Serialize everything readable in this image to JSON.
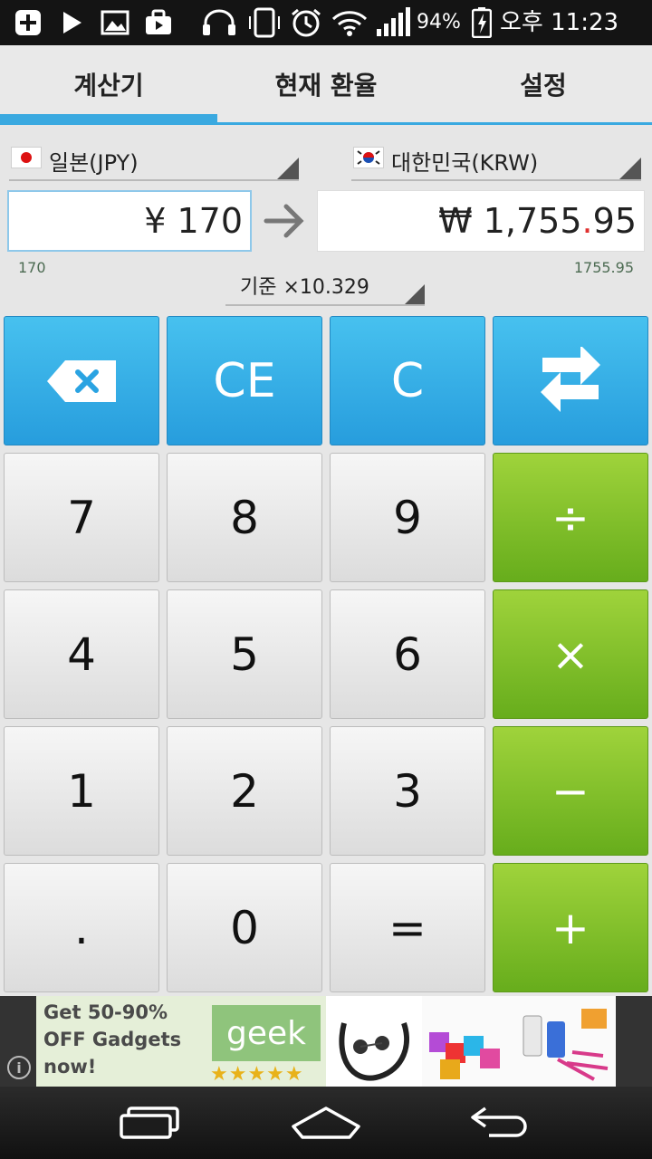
{
  "status_bar": {
    "battery": "94%",
    "time": "오후 11:23",
    "icons": [
      "add-icon",
      "play-icon",
      "image-icon",
      "bag-icon",
      "headset-icon",
      "vibrate-icon",
      "alarm-icon",
      "wifi-icon",
      "signal-icon",
      "battery-icon"
    ]
  },
  "tabs": [
    {
      "label": "계산기",
      "active": true
    },
    {
      "label": "현재 환율",
      "active": false
    },
    {
      "label": "설정",
      "active": false
    }
  ],
  "from_currency": {
    "label": "일본(JPY)",
    "flag": "japan-flag-icon",
    "amount": "¥ 170",
    "raw": "170"
  },
  "to_currency": {
    "label": "대한민국(KRW)",
    "flag": "korea-flag-icon",
    "amount_prefix": "₩ 1,755",
    "amount_dot": ".",
    "amount_suffix": "95",
    "raw": "1755.95"
  },
  "rate": {
    "label": "기준 ×10.329"
  },
  "keys": {
    "backspace": "backspace-icon",
    "ce": "CE",
    "c": "C",
    "swap": "swap-icon",
    "k7": "7",
    "k8": "8",
    "k9": "9",
    "divide": "÷",
    "k4": "4",
    "k5": "5",
    "k6": "6",
    "multiply": "×",
    "k1": "1",
    "k2": "2",
    "k3": "3",
    "minus": "−",
    "dot": ".",
    "k0": "0",
    "equals": "=",
    "plus": "+"
  },
  "ad": {
    "line1": "Get 50-90%",
    "line2": "OFF Gadgets",
    "line3": "now!",
    "brand": "geek"
  },
  "colors": {
    "accent": "#3aa9e0",
    "blue_key": "#34afe8",
    "green_key": "#80c12a",
    "dot_red": "#e0302f"
  }
}
